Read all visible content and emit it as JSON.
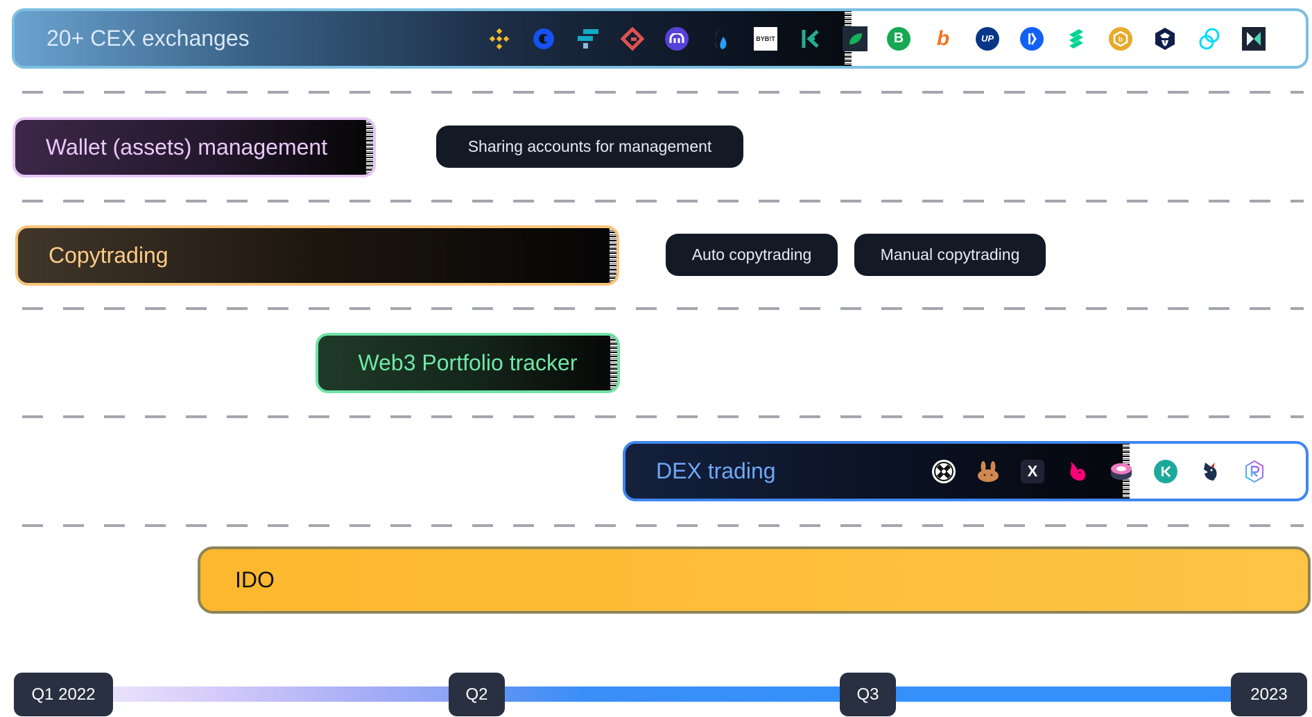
{
  "rows": {
    "cex": {
      "label": "20+ CEX exchanges",
      "border_color": "#7cbfe0",
      "icons": [
        "binance-icon",
        "coinbase-icon",
        "ftx-icon",
        "gateio-icon",
        "kraken-icon",
        "huobi-icon",
        "bybit-icon",
        "kucoin-icon",
        "bitfinex-icon",
        "bittrex-icon",
        "bithumb-icon",
        "upbit-icon",
        "bitso-icon",
        "compound-icon",
        "bitrue-icon",
        "crypto-com-icon",
        "gemini-icon",
        "hotbit-icon"
      ],
      "bybit_text": "BYB!T"
    },
    "wallet": {
      "label": "Wallet (assets) management",
      "border_color": "#e6c6f7",
      "sub_features": [
        "Sharing accounts for management"
      ]
    },
    "copytrading": {
      "label": "Copytrading",
      "border_color": "#f8c57a",
      "sub_features": [
        "Auto copytrading",
        "Manual copytrading"
      ]
    },
    "web3": {
      "label": "Web3 Portfolio tracker",
      "border_color": "#6fe3a6"
    },
    "dex": {
      "label": "DEX trading",
      "border_color": "#3f86f0",
      "icons": [
        "0x-icon",
        "pancakeswap-icon",
        "dydx-icon",
        "uniswap-icon",
        "sushiswap-icon",
        "kyberswap-icon",
        "1inch-icon",
        "raydium-icon"
      ],
      "dydx_text": "X"
    },
    "ido": {
      "label": "IDO",
      "border_color": "#8e8458",
      "fill_color": "#fdb92f"
    }
  },
  "timeline": {
    "milestones": [
      "Q1 2022",
      "Q2",
      "Q3",
      "2023"
    ]
  }
}
